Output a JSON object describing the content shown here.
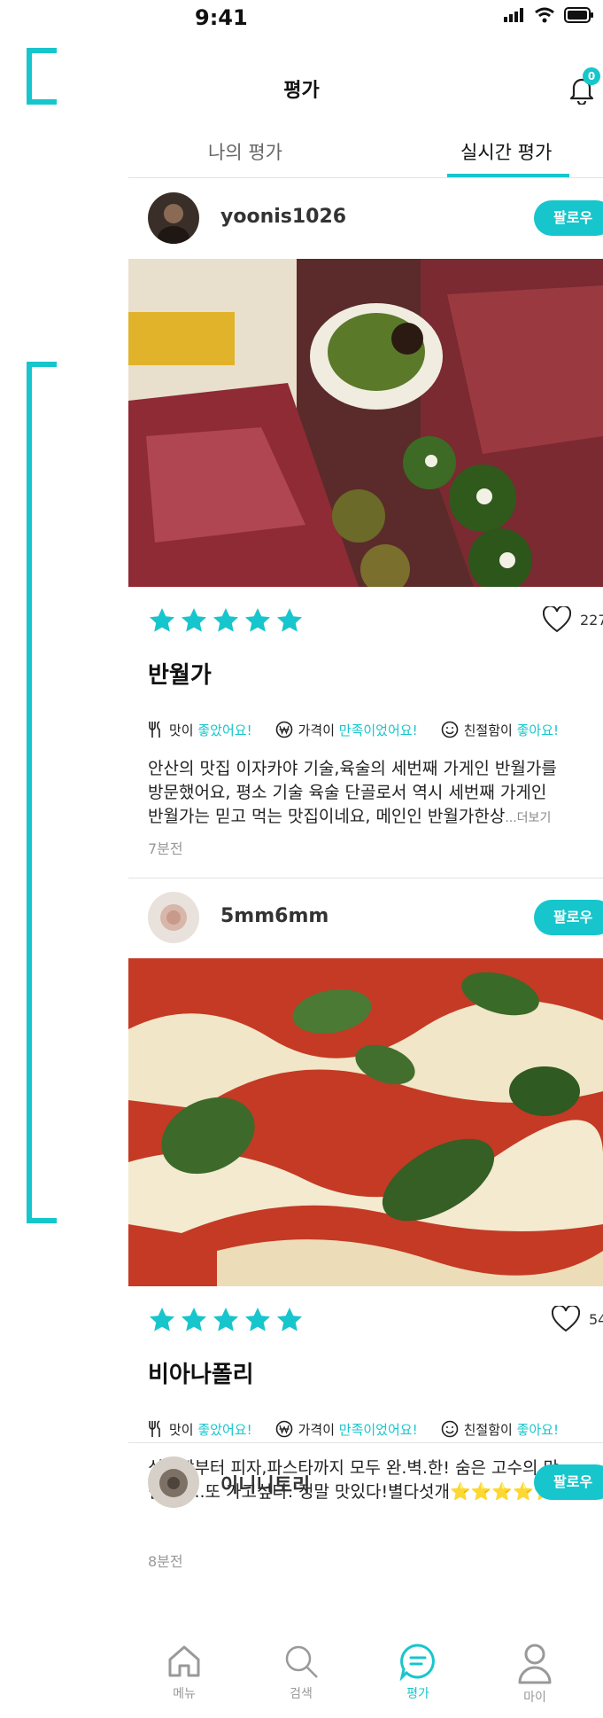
{
  "status": {
    "time": "9:41"
  },
  "header": {
    "title": "평가",
    "notification_count": "0"
  },
  "tabs": [
    {
      "label": "나의 평가"
    },
    {
      "label": "실시간 평가",
      "active": true
    }
  ],
  "posts": [
    {
      "username": "yoonis1026",
      "follow_label": "팔로우",
      "rating": 5,
      "likes": "227",
      "place": "반월가",
      "tags": {
        "taste": {
          "prefix": "맛이 ",
          "value": "좋았어요!"
        },
        "price": {
          "prefix": "가격이 ",
          "value": "만족이었어요!"
        },
        "kindness": {
          "prefix": "친절함이 ",
          "value": "좋아요!"
        }
      },
      "review_lines": [
        "안산의 맛집 이자카야 기술,육술의 세번째 가게인 반월가를",
        "방문했어요, 평소 기술 육술 단골로서 역시 세번째 가게인",
        "반월가는 믿고 먹는 맛집이네요, 메인인 반월가한상"
      ],
      "more_label": "...더보기",
      "time": "7분전"
    },
    {
      "username": "5mm6mm",
      "follow_label": "팔로우",
      "rating": 5,
      "likes": "54",
      "place": "비아나폴리",
      "tags": {
        "taste": {
          "prefix": "맛이 ",
          "value": "좋았어요!"
        },
        "price": {
          "prefix": "가격이 ",
          "value": "만족이었어요!"
        },
        "kindness": {
          "prefix": "친절함이 ",
          "value": "좋아요!"
        }
      },
      "review_lines": [
        "식전빵부터 피자,파스타까지 모두 완.벽.한! 숨은 고수의 맛",
        "집이다..또 가고싶다. 정말 맛있다!별다섯개⭐⭐⭐⭐⭐"
      ],
      "time": "8분전"
    },
    {
      "username": "이니니토리",
      "follow_label": "팔로우"
    }
  ],
  "bottom_nav": [
    {
      "label": "메뉴",
      "icon": "home-icon"
    },
    {
      "label": "검색",
      "icon": "search-icon"
    },
    {
      "label": "평가",
      "icon": "chat-icon",
      "active": true
    },
    {
      "label": "마이",
      "icon": "user-icon"
    }
  ],
  "colors": {
    "accent": "#16c6cc"
  }
}
